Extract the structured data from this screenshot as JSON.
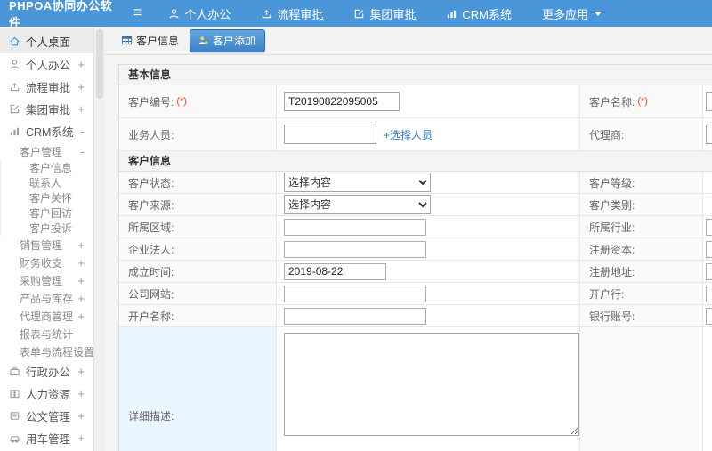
{
  "topbar": {
    "brand": "PHPOA协同办公软件",
    "nav": [
      {
        "label": "个人办公",
        "icon": "user"
      },
      {
        "label": "流程审批",
        "icon": "approval"
      },
      {
        "label": "集团审批",
        "icon": "edit"
      },
      {
        "label": "CRM系统",
        "icon": "chart"
      },
      {
        "label": "更多应用",
        "icon": "caret"
      }
    ]
  },
  "sidebar": {
    "items": [
      {
        "label": "个人桌面",
        "icon": "home",
        "level": 0,
        "active": true,
        "exp": ""
      },
      {
        "label": "个人办公",
        "icon": "user",
        "level": 0,
        "exp": "+"
      },
      {
        "label": "流程审批",
        "icon": "approval",
        "level": 0,
        "exp": "+"
      },
      {
        "label": "集团审批",
        "icon": "edit",
        "level": 0,
        "exp": "+"
      },
      {
        "label": "CRM系统",
        "icon": "chart",
        "level": 0,
        "exp": "-"
      },
      {
        "label": "客户管理",
        "level": 1,
        "exp": "-"
      },
      {
        "label": "客户信息",
        "level": 2,
        "exp": ""
      },
      {
        "label": "联系人",
        "level": 2,
        "exp": ""
      },
      {
        "label": "客户关怀",
        "level": 2,
        "exp": ""
      },
      {
        "label": "客户回访",
        "level": 2,
        "exp": ""
      },
      {
        "label": "客户投诉",
        "level": 2,
        "exp": ""
      },
      {
        "label": "销售管理",
        "level": 1,
        "exp": "+"
      },
      {
        "label": "财务收支",
        "level": 1,
        "exp": "+"
      },
      {
        "label": "采购管理",
        "level": 1,
        "exp": "+"
      },
      {
        "label": "产品与库存",
        "level": 1,
        "exp": "+"
      },
      {
        "label": "代理商管理",
        "level": 1,
        "exp": "+"
      },
      {
        "label": "报表与统计",
        "level": 1,
        "exp": ""
      },
      {
        "label": "表单与流程设置+",
        "level": 1,
        "exp": ""
      },
      {
        "label": "行政办公",
        "icon": "briefcase",
        "level": 0,
        "exp": "+"
      },
      {
        "label": "人力资源",
        "icon": "book",
        "level": 0,
        "exp": "+"
      },
      {
        "label": "公文管理",
        "icon": "doc",
        "level": 0,
        "exp": "+"
      },
      {
        "label": "用车管理",
        "icon": "car",
        "level": 0,
        "exp": "+"
      }
    ]
  },
  "tabs": [
    {
      "label": "客户信息",
      "icon": "grid",
      "active": false
    },
    {
      "label": "客户添加",
      "icon": "useradd",
      "active": true
    }
  ],
  "form": {
    "required_marker": "(*)",
    "choose_person_link": "+选择人员",
    "sections": [
      {
        "title": "基本信息",
        "rows": [
          {
            "label": "客户编号:",
            "required": true,
            "type": "text",
            "value": "T20190822095005",
            "label2": "客户名称:",
            "required2": true,
            "right_input": true
          },
          {
            "label": "业务人员:",
            "required": false,
            "type": "person-picker",
            "value": "",
            "label2": "代理商:",
            "required2": false,
            "right_input": true
          }
        ]
      },
      {
        "title": "客户信息",
        "rows": [
          {
            "label": "客户状态:",
            "type": "select",
            "value": "选择内容",
            "label2": "客户等级:",
            "right_input": false
          },
          {
            "label": "客户来源:",
            "type": "select",
            "value": "选择内容",
            "label2": "客户类别:",
            "right_input": false
          },
          {
            "label": "所属区域:",
            "type": "text",
            "value": "",
            "label2": "所属行业:",
            "right_input": true
          },
          {
            "label": "企业法人:",
            "type": "text",
            "value": "",
            "label2": "注册资本:",
            "right_input": true
          },
          {
            "label": "成立时间:",
            "type": "text",
            "value": "2019-08-22",
            "label2": "注册地址:",
            "right_input": true
          },
          {
            "label": "公司网站:",
            "type": "text",
            "value": "",
            "label2": "开户行:",
            "right_input": true
          },
          {
            "label": "开户名称:",
            "type": "text",
            "value": "",
            "label2": "银行账号:",
            "right_input": true
          },
          {
            "label": "详细描述:",
            "type": "textarea",
            "value": "",
            "label2": "",
            "right_input": false
          }
        ]
      }
    ]
  },
  "colors": {
    "topbar_blue": "#4a96d8",
    "active_tab_blue": "#3c82c4",
    "link_blue": "#2b7bc7",
    "required_red": "#ff4422"
  }
}
